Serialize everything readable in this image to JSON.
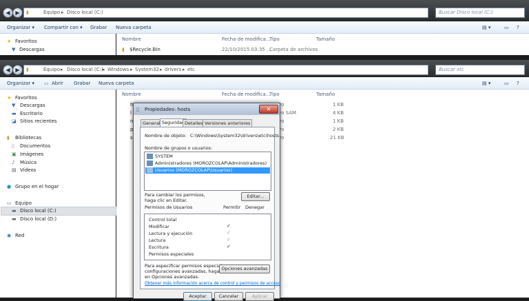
{
  "window1": {
    "address": [
      "Equipo",
      "Disco local (C:)"
    ],
    "search_placeholder": "Buscar Disco local (C:)",
    "toolbar": [
      "Organizar ▾",
      "Compartir con ▾",
      "Grabar",
      "Nueva carpeta"
    ],
    "sidebar": {
      "favorites": "Favoritos",
      "item": "Descargas"
    },
    "columns": [
      "Nombre",
      "Fecha de modifica...",
      "Tipo",
      "Tamaño"
    ],
    "row": {
      "name": "$Recycle.Bin",
      "date": "22/10/2015 03:35 ...",
      "type": "Carpeta de archivos"
    }
  },
  "window2": {
    "address": [
      "Equipo",
      "Disco local (C:)",
      "Windows",
      "System32",
      "drivers",
      "etc"
    ],
    "search_placeholder": "Buscar etc",
    "toolbar": [
      "Organizar ▾",
      "Abrir",
      "Grabar",
      "Nueva carpeta"
    ],
    "sidebar": {
      "favorites": "Favoritos",
      "fav_items": [
        "Descargas",
        "Escritorio",
        "Sitios recientes"
      ],
      "libraries": "Bibliotecas",
      "lib_items": [
        "Documentos",
        "Imágenes",
        "Música",
        "Vídeos"
      ],
      "homegroup": "Grupo en el hogar",
      "computer": "Equipo",
      "drives": [
        "Disco local (C:)",
        "Disco local (D:)"
      ],
      "network": "Red"
    },
    "columns": [
      "Nombre",
      "Fecha de modifica...",
      "Tipo",
      "Tamaño"
    ],
    "files": [
      {
        "name": "h",
        "type": "vo",
        "size": "1 KB"
      },
      {
        "name": "l",
        "type": "vo SAM",
        "size": "4 KB"
      },
      {
        "name": "n",
        "type": "vo",
        "size": "1 KB"
      },
      {
        "name": "p",
        "type": "vo",
        "size": "2 KB"
      },
      {
        "name": "s",
        "type": "vo",
        "size": "21 KB"
      }
    ]
  },
  "dialog": {
    "title": "Propiedades: hosts",
    "tabs": [
      "General",
      "Seguridad",
      "Detalles",
      "Versiones anteriores"
    ],
    "object_label": "Nombre de objeto:",
    "object_value": "C:\\Windows\\System32\\drivers\\etc\\hosts",
    "groups_label": "Nombre de grupos o usuarios:",
    "groups": [
      "SYSTEM",
      "Administradores (MOROZCOLAP\\Administradores)",
      "Usuarios (MOROZCOLAP\\Usuarios)"
    ],
    "change_text": [
      "Para cambiar los permisos,",
      "haga clic en Editar."
    ],
    "edit_button": "Editar...",
    "perm_header": "Permisos de Usuarios",
    "allow": "Permitir",
    "deny": "Denegar",
    "permissions": [
      {
        "name": "Control total",
        "allow": ""
      },
      {
        "name": "Modificar",
        "allow": "✓"
      },
      {
        "name": "Lectura y ejecución",
        "allow": "✓"
      },
      {
        "name": "Lectura",
        "allow": "✓"
      },
      {
        "name": "Escritura",
        "allow": "✓"
      },
      {
        "name": "Permisos especiales",
        "allow": ""
      }
    ],
    "special_text": [
      "Para especificar permisos especiales o",
      "configuraciones avanzadas, haga clic",
      "en Opciones avanzadas."
    ],
    "advanced_button": "Opciones avanzadas",
    "link": "Obtener más información acerca de control y permisos de acceso",
    "buttons": [
      "Aceptar",
      "Cancelar",
      "Aplicar"
    ]
  },
  "colors": {
    "selection": "#3399ff",
    "link": "#0066cc"
  }
}
